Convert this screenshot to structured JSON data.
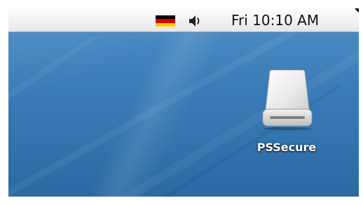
{
  "menubar": {
    "input_flag": {
      "icon": "german-flag-icon",
      "colors": [
        "#000000",
        "#dd0000",
        "#ffce00"
      ]
    },
    "volume": {
      "icon": "speaker-volume-icon"
    },
    "clock": {
      "text": "Fri 10:10 AM"
    }
  },
  "desktop": {
    "drive": {
      "icon": "external-hard-drive-icon",
      "label": "PSSecure"
    }
  }
}
